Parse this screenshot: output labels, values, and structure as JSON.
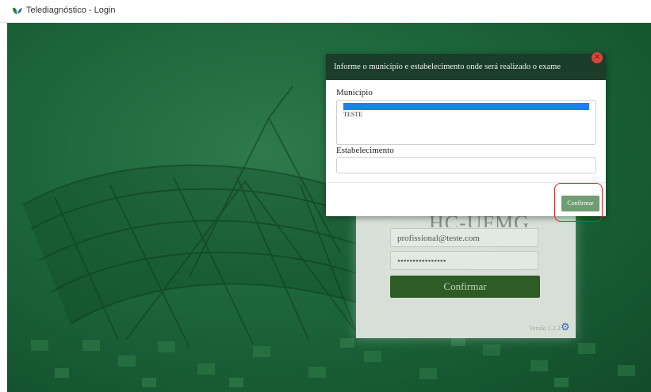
{
  "window": {
    "title": "Telediagnóstico - Login"
  },
  "modal": {
    "title": "Informe o município e estabelecimento onde será realizado o exame",
    "close_icon": "close-icon",
    "municipio_label": "Município",
    "municipio_options": [
      "",
      "TESTE"
    ],
    "estabelecimento_label": "Estabelecimento",
    "estabelecimento_value": "",
    "confirm_label": "Confirmar"
  },
  "login": {
    "brand": "HC-UFMG",
    "email_value": "profissional@teste.com",
    "password_value": "••••••••••••••••",
    "confirm_label": "Confirmar",
    "version": "Versão 1.2.3",
    "gear_icon": "gear-icon"
  },
  "colors": {
    "background_green": "#1f6a3e",
    "modal_header": "#1b3d2a",
    "confirm_button": "#6f9c70",
    "highlight_red": "#e02020",
    "selected_option": "#1e80e8"
  }
}
